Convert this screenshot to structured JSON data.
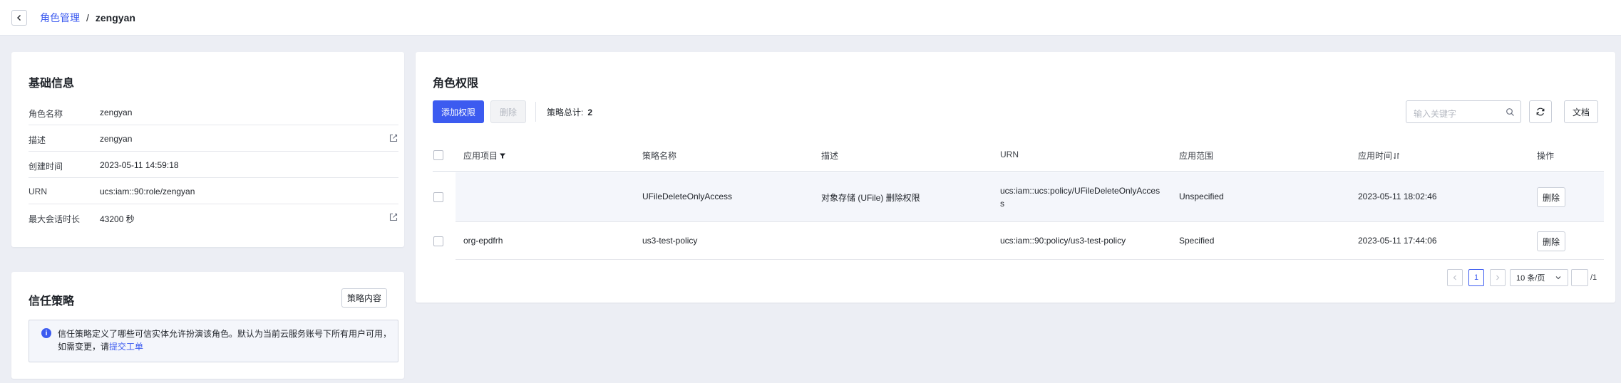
{
  "header": {
    "breadcrumb_parent": "角色管理",
    "breadcrumb_sep": "/",
    "breadcrumb_current": "zengyan"
  },
  "basic_info": {
    "title": "基础信息",
    "rows": [
      {
        "label": "角色名称",
        "value": "zengyan"
      },
      {
        "label": "描述",
        "value": "zengyan"
      },
      {
        "label": "创建时间",
        "value": "2023-05-11 14:59:18"
      },
      {
        "label": "URN",
        "value": "ucs:iam::90:role/zengyan"
      },
      {
        "label": "最大会话时长",
        "value": "43200 秒"
      }
    ]
  },
  "trust_policy": {
    "title": "信任策略",
    "button": "策略内容",
    "notice_text": "信任策略定义了哪些可信实体允许扮演该角色。默认为当前云服务账号下所有用户可用，如需变更，请",
    "notice_link": "提交工单"
  },
  "permissions": {
    "title": "角色权限",
    "add_button": "添加权限",
    "delete_button": "删除",
    "total_label": "策略总计:",
    "total_value": "2",
    "search_placeholder": "输入关键字",
    "docs_button": "文档",
    "columns": {
      "project": "应用项目",
      "policy_name": "策略名称",
      "description": "描述",
      "urn": "URN",
      "scope": "应用范围",
      "time": "应用时间",
      "action": "操作"
    },
    "rows": [
      {
        "project": "",
        "policy_name": "UFileDeleteOnlyAccess",
        "description": "对象存储 (UFile) 删除权限",
        "urn_line1": "ucs:iam::ucs:policy/UFileDeleteOnlyAcces",
        "urn_line2": "s",
        "scope": "Unspecified",
        "time": "2023-05-11 18:02:46",
        "action": "删除"
      },
      {
        "project": "org-epdfrh",
        "policy_name": "us3-test-policy",
        "description": "",
        "urn_line1": "ucs:iam::90:policy/us3-test-policy",
        "urn_line2": "",
        "scope": "Specified",
        "time": "2023-05-11 17:44:06",
        "action": "删除"
      }
    ],
    "pagination": {
      "current_page": "1",
      "page_size": "10 条/页",
      "jump_value": "",
      "total_pages": "/1"
    }
  },
  "colors": {
    "accent": "#3c5bf0",
    "page_bg": "#eceef4",
    "row_highlight": "#f4f6fb"
  }
}
